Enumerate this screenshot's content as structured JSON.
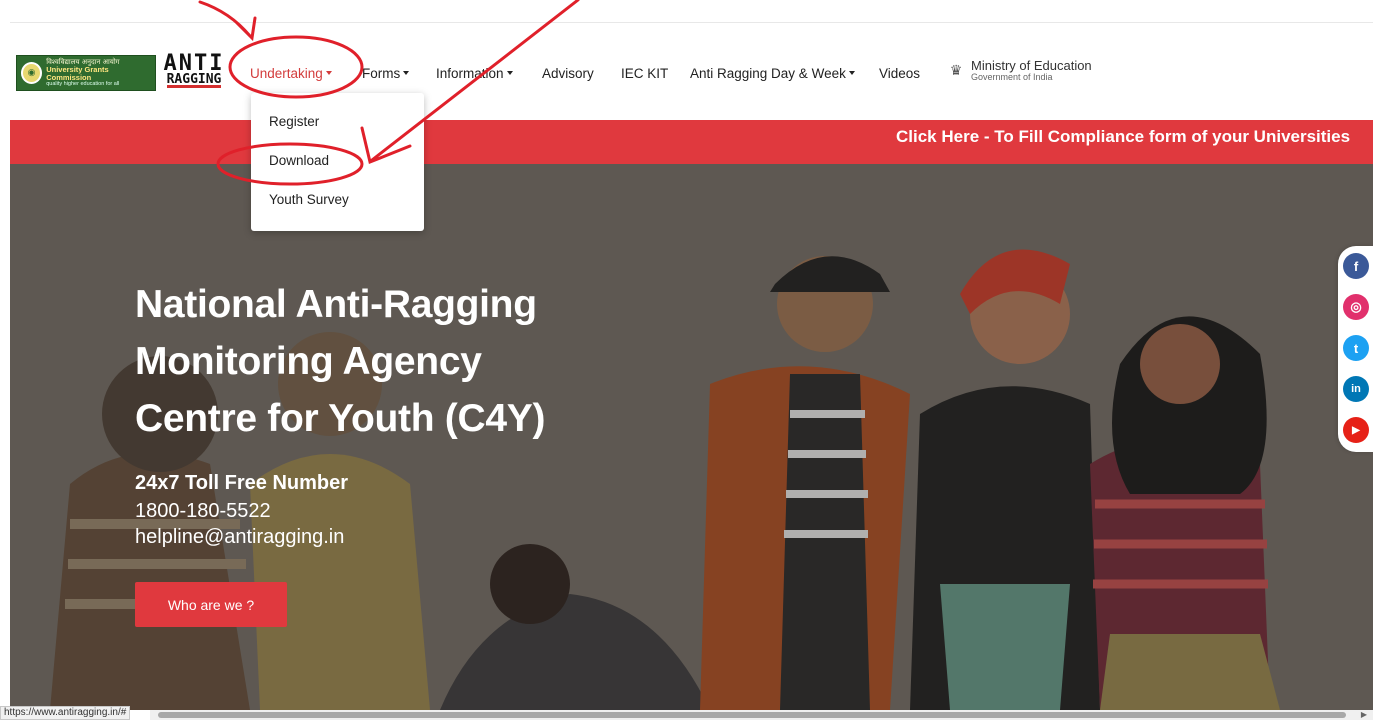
{
  "logos": {
    "ugc_hindi": "विश्वविद्यालय अनुदान आयोग",
    "ugc_english": "University Grants Commission",
    "ugc_tagline": "quality higher education for all",
    "anti_ragging_top": "ANTI",
    "anti_ragging_bottom": "RAGGING",
    "ministry_title": "Ministry of Education",
    "ministry_subtitle": "Government of India"
  },
  "nav": {
    "items": [
      {
        "label": "Undertaking",
        "dropdown": true,
        "active": true
      },
      {
        "label": "Forms",
        "dropdown": true
      },
      {
        "label": "Information",
        "dropdown": true
      },
      {
        "label": "Advisory",
        "dropdown": false
      },
      {
        "label": "IEC KIT",
        "dropdown": false
      },
      {
        "label": "Anti Ragging Day & Week",
        "dropdown": true
      },
      {
        "label": "Videos",
        "dropdown": false
      }
    ]
  },
  "dropdown": {
    "items": [
      {
        "label": "Register"
      },
      {
        "label": "Download"
      },
      {
        "label": "Youth Survey"
      }
    ]
  },
  "compliance_bar": {
    "text": "Click Here - To Fill Compliance form of your Universities"
  },
  "hero": {
    "title_lines": [
      "National Anti-Ragging",
      "Monitoring Agency",
      "Centre for Youth (C4Y)"
    ],
    "toll_label": "24x7 Toll Free Number",
    "toll_number": "1800-180-5522",
    "email": "helpline@antiragging.in",
    "button_label": "Who are we ?"
  },
  "social": [
    {
      "name": "facebook-icon",
      "glyph": "f",
      "color": "#3b5998"
    },
    {
      "name": "instagram-icon",
      "glyph": "◎",
      "color": "#e1306c"
    },
    {
      "name": "twitter-icon",
      "glyph": "t",
      "color": "#1da1f2"
    },
    {
      "name": "linkedin-icon",
      "glyph": "in",
      "color": "#0077b5"
    },
    {
      "name": "youtube-icon",
      "glyph": "▶",
      "color": "#e62117"
    }
  ],
  "status_bar": {
    "url": "https://www.antiragging.in/#"
  },
  "colors": {
    "accent_red": "#e0393e",
    "nav_active": "#d33c3c",
    "annotation_red": "#e0202a"
  }
}
